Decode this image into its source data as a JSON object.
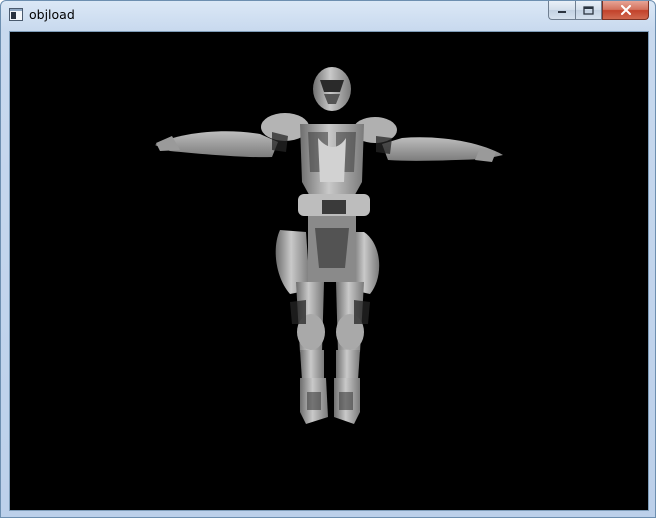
{
  "window": {
    "title": "objload",
    "icon": "console-window-icon",
    "minimize_icon": "minimize-icon",
    "maximize_icon": "maximize-icon",
    "close_icon": "close-icon"
  },
  "viewport": {
    "background": "#000000",
    "content": "3d-model-render"
  }
}
